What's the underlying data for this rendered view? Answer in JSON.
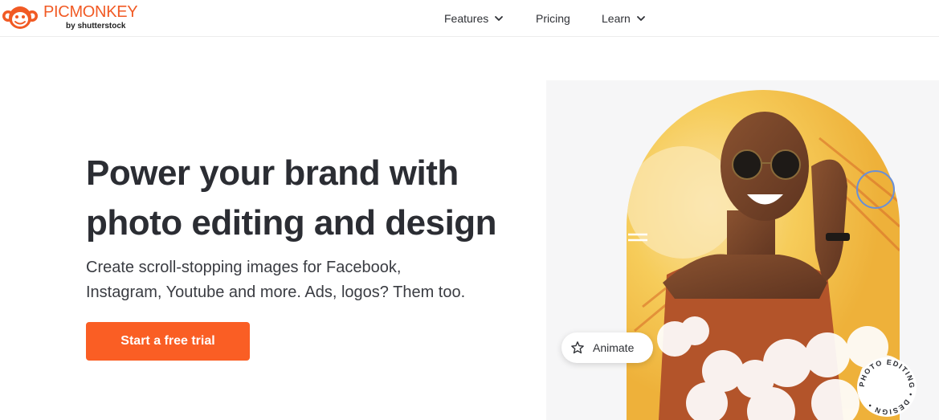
{
  "header": {
    "logo": {
      "wordmark": "PICMONKEY",
      "byline": "by shutterstock"
    },
    "nav": [
      {
        "label": "Features",
        "has_dropdown": true
      },
      {
        "label": "Pricing",
        "has_dropdown": false
      },
      {
        "label": "Learn",
        "has_dropdown": true
      }
    ]
  },
  "hero": {
    "title_lines": [
      "Power your brand with",
      "photo editing and design"
    ],
    "subtitle_lines": [
      "Create scroll-stopping images for Facebook,",
      "Instagram, Youtube and more. Ads, logos? Them too."
    ],
    "cta_label": "Start a free trial"
  },
  "hero_image": {
    "animate_label": "Animate",
    "badge_text": "PHOTO EDITING • DESIGN •"
  },
  "colors": {
    "brand_orange": "#f15a24",
    "cta_orange": "#fa5e24",
    "text_dark": "#2b2d33",
    "arch_yellow": "#f4c13a",
    "top_color": "#b3542a"
  },
  "icons": {
    "logo_mark": "monkey-face-icon",
    "nav_chevron": "chevron-down-icon",
    "animate": "star-icon"
  }
}
